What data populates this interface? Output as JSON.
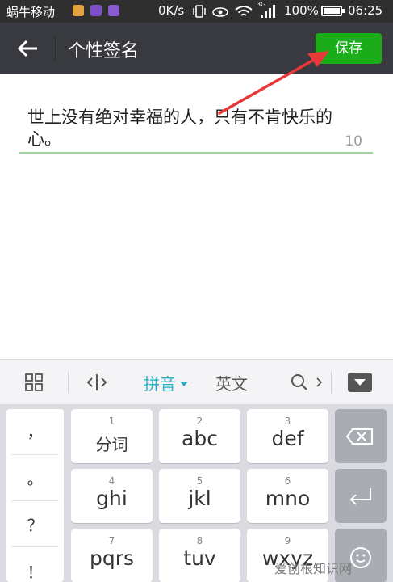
{
  "status_bar": {
    "carrier": "蜗牛移动",
    "net_speed": "0K/s",
    "network": "3G",
    "battery": "100%",
    "time": "06:25",
    "icons": [
      "app-icon-1",
      "app-icon-2",
      "app-icon-3",
      "vibrate-icon",
      "eye-icon",
      "wifi-icon",
      "signal-icon",
      "battery-icon"
    ]
  },
  "header": {
    "title": "个性签名",
    "save_label": "保存",
    "back_icon": "back-arrow-icon"
  },
  "editor": {
    "value": "世上没有绝对幸福的人，只有不肯快乐的心。",
    "remaining_count": "10"
  },
  "keyboard": {
    "toolbar": {
      "grid_icon": "grid-icon",
      "cursor_icon": "cursor-icon",
      "pinyin": "拼音",
      "english": "英文",
      "search_icon": "search-icon",
      "more_icon": "chevron-right-icon",
      "collapse_icon": "keyboard-collapse-icon"
    },
    "punctuation": [
      "，",
      "。",
      "？",
      "！"
    ],
    "keys": [
      {
        "num": "1",
        "letters": "分词"
      },
      {
        "num": "2",
        "letters": "abc"
      },
      {
        "num": "3",
        "letters": "def"
      },
      {
        "num": "4",
        "letters": "ghi"
      },
      {
        "num": "5",
        "letters": "jkl"
      },
      {
        "num": "6",
        "letters": "mno"
      },
      {
        "num": "7",
        "letters": "pqrs"
      },
      {
        "num": "8",
        "letters": "tuv"
      },
      {
        "num": "9",
        "letters": "wxyz"
      }
    ],
    "function_keys": [
      "backspace-icon",
      "enter-icon",
      "emoji-icon"
    ]
  },
  "watermark": "爱创根知识网",
  "colors": {
    "titlebar": "#393a3f",
    "save_button": "#1aad19",
    "accent_pinyin": "#2ab0c6",
    "annotation_arrow": "#e8383a"
  }
}
